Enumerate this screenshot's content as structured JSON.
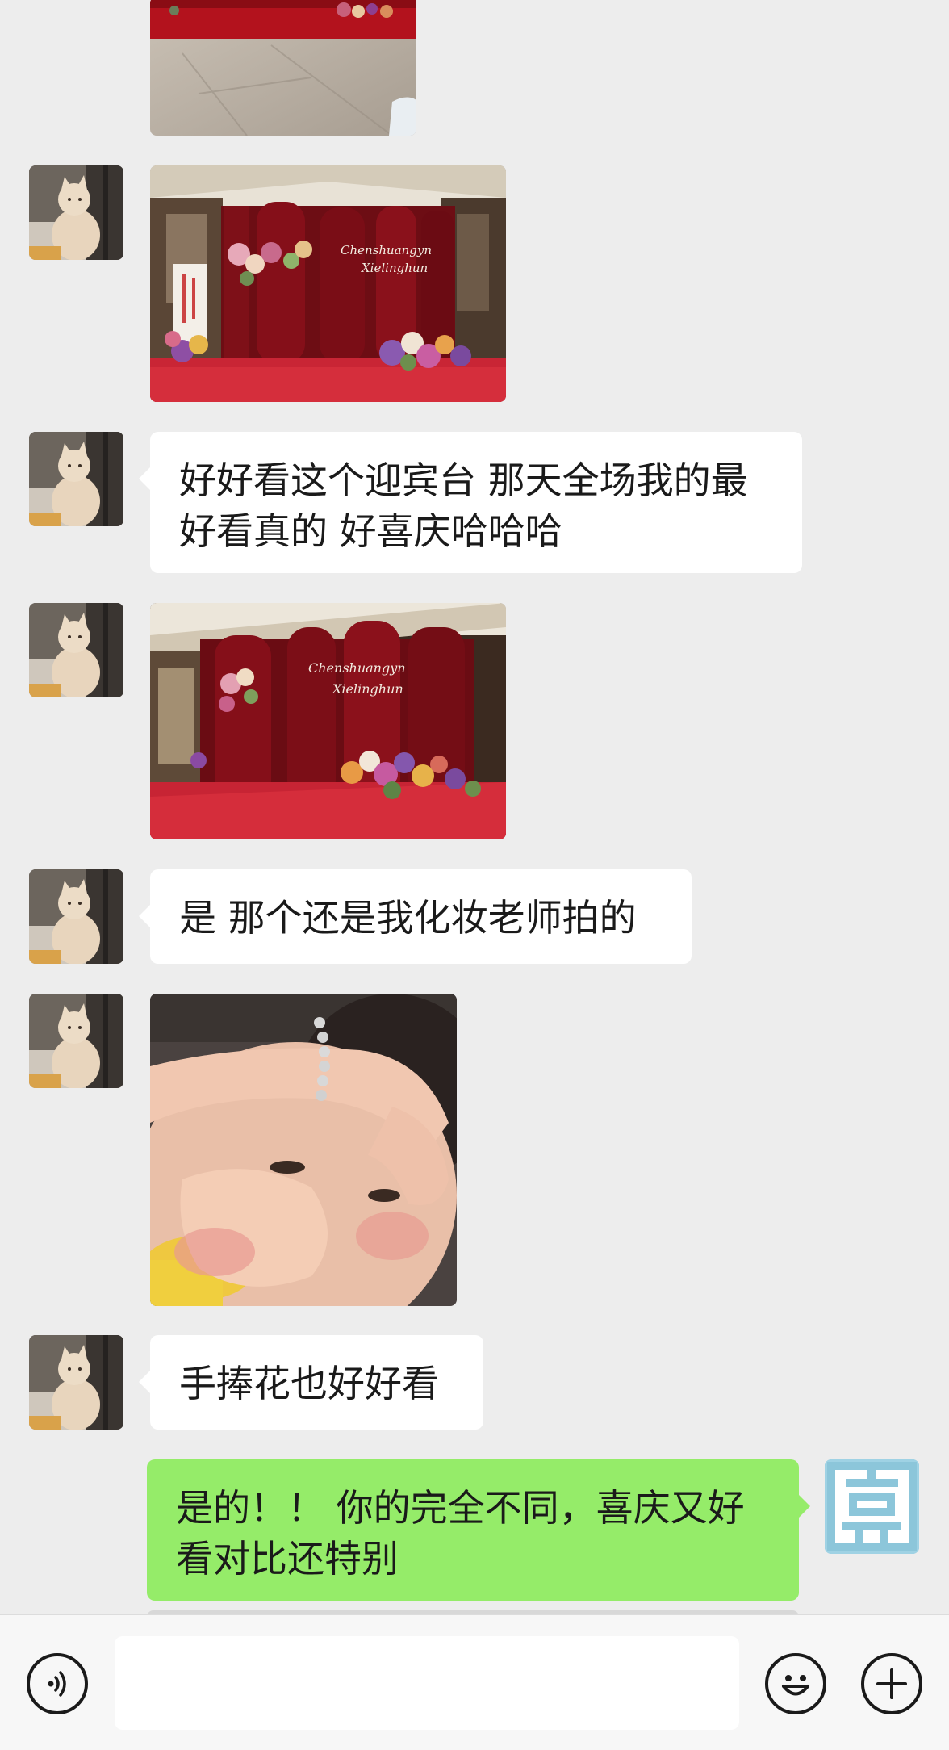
{
  "messages": [
    {
      "type": "image",
      "sender": "other",
      "content": "red wedding carpet photo (cropped)"
    },
    {
      "type": "image",
      "sender": "other",
      "content": "red velvet wedding backdrop with flowers"
    },
    {
      "type": "text",
      "sender": "other",
      "lines": [
        "好好看这个迎宾台 那天全场我的最",
        "好看真的 好喜庆哈哈哈"
      ]
    },
    {
      "type": "image",
      "sender": "other",
      "content": "red velvet wedding backdrop side view"
    },
    {
      "type": "text",
      "sender": "other",
      "lines": [
        "是 那个还是我化妆老师拍的"
      ]
    },
    {
      "type": "image",
      "sender": "other",
      "content": "child covering face sticker"
    },
    {
      "type": "text",
      "sender": "other",
      "lines": [
        "手捧花也好好看"
      ]
    },
    {
      "type": "text",
      "sender": "self",
      "lines": [
        "是的！！ 你的完全不同，喜庆又好",
        "看对比还特别"
      ]
    }
  ],
  "backdrop_script": {
    "line1": "Chenshuangyn",
    "line2": "Xielinghun"
  },
  "composer": {
    "input_value": "",
    "voice_icon": "voice-icon",
    "emoji_icon": "emoji-icon",
    "plus_icon": "plus-icon"
  },
  "colors": {
    "background": "#ededed",
    "incoming_bubble": "#ffffff",
    "outgoing_bubble": "#95ec69",
    "bottom_bar": "#f7f7f7",
    "self_avatar": "#8ec8dc"
  }
}
